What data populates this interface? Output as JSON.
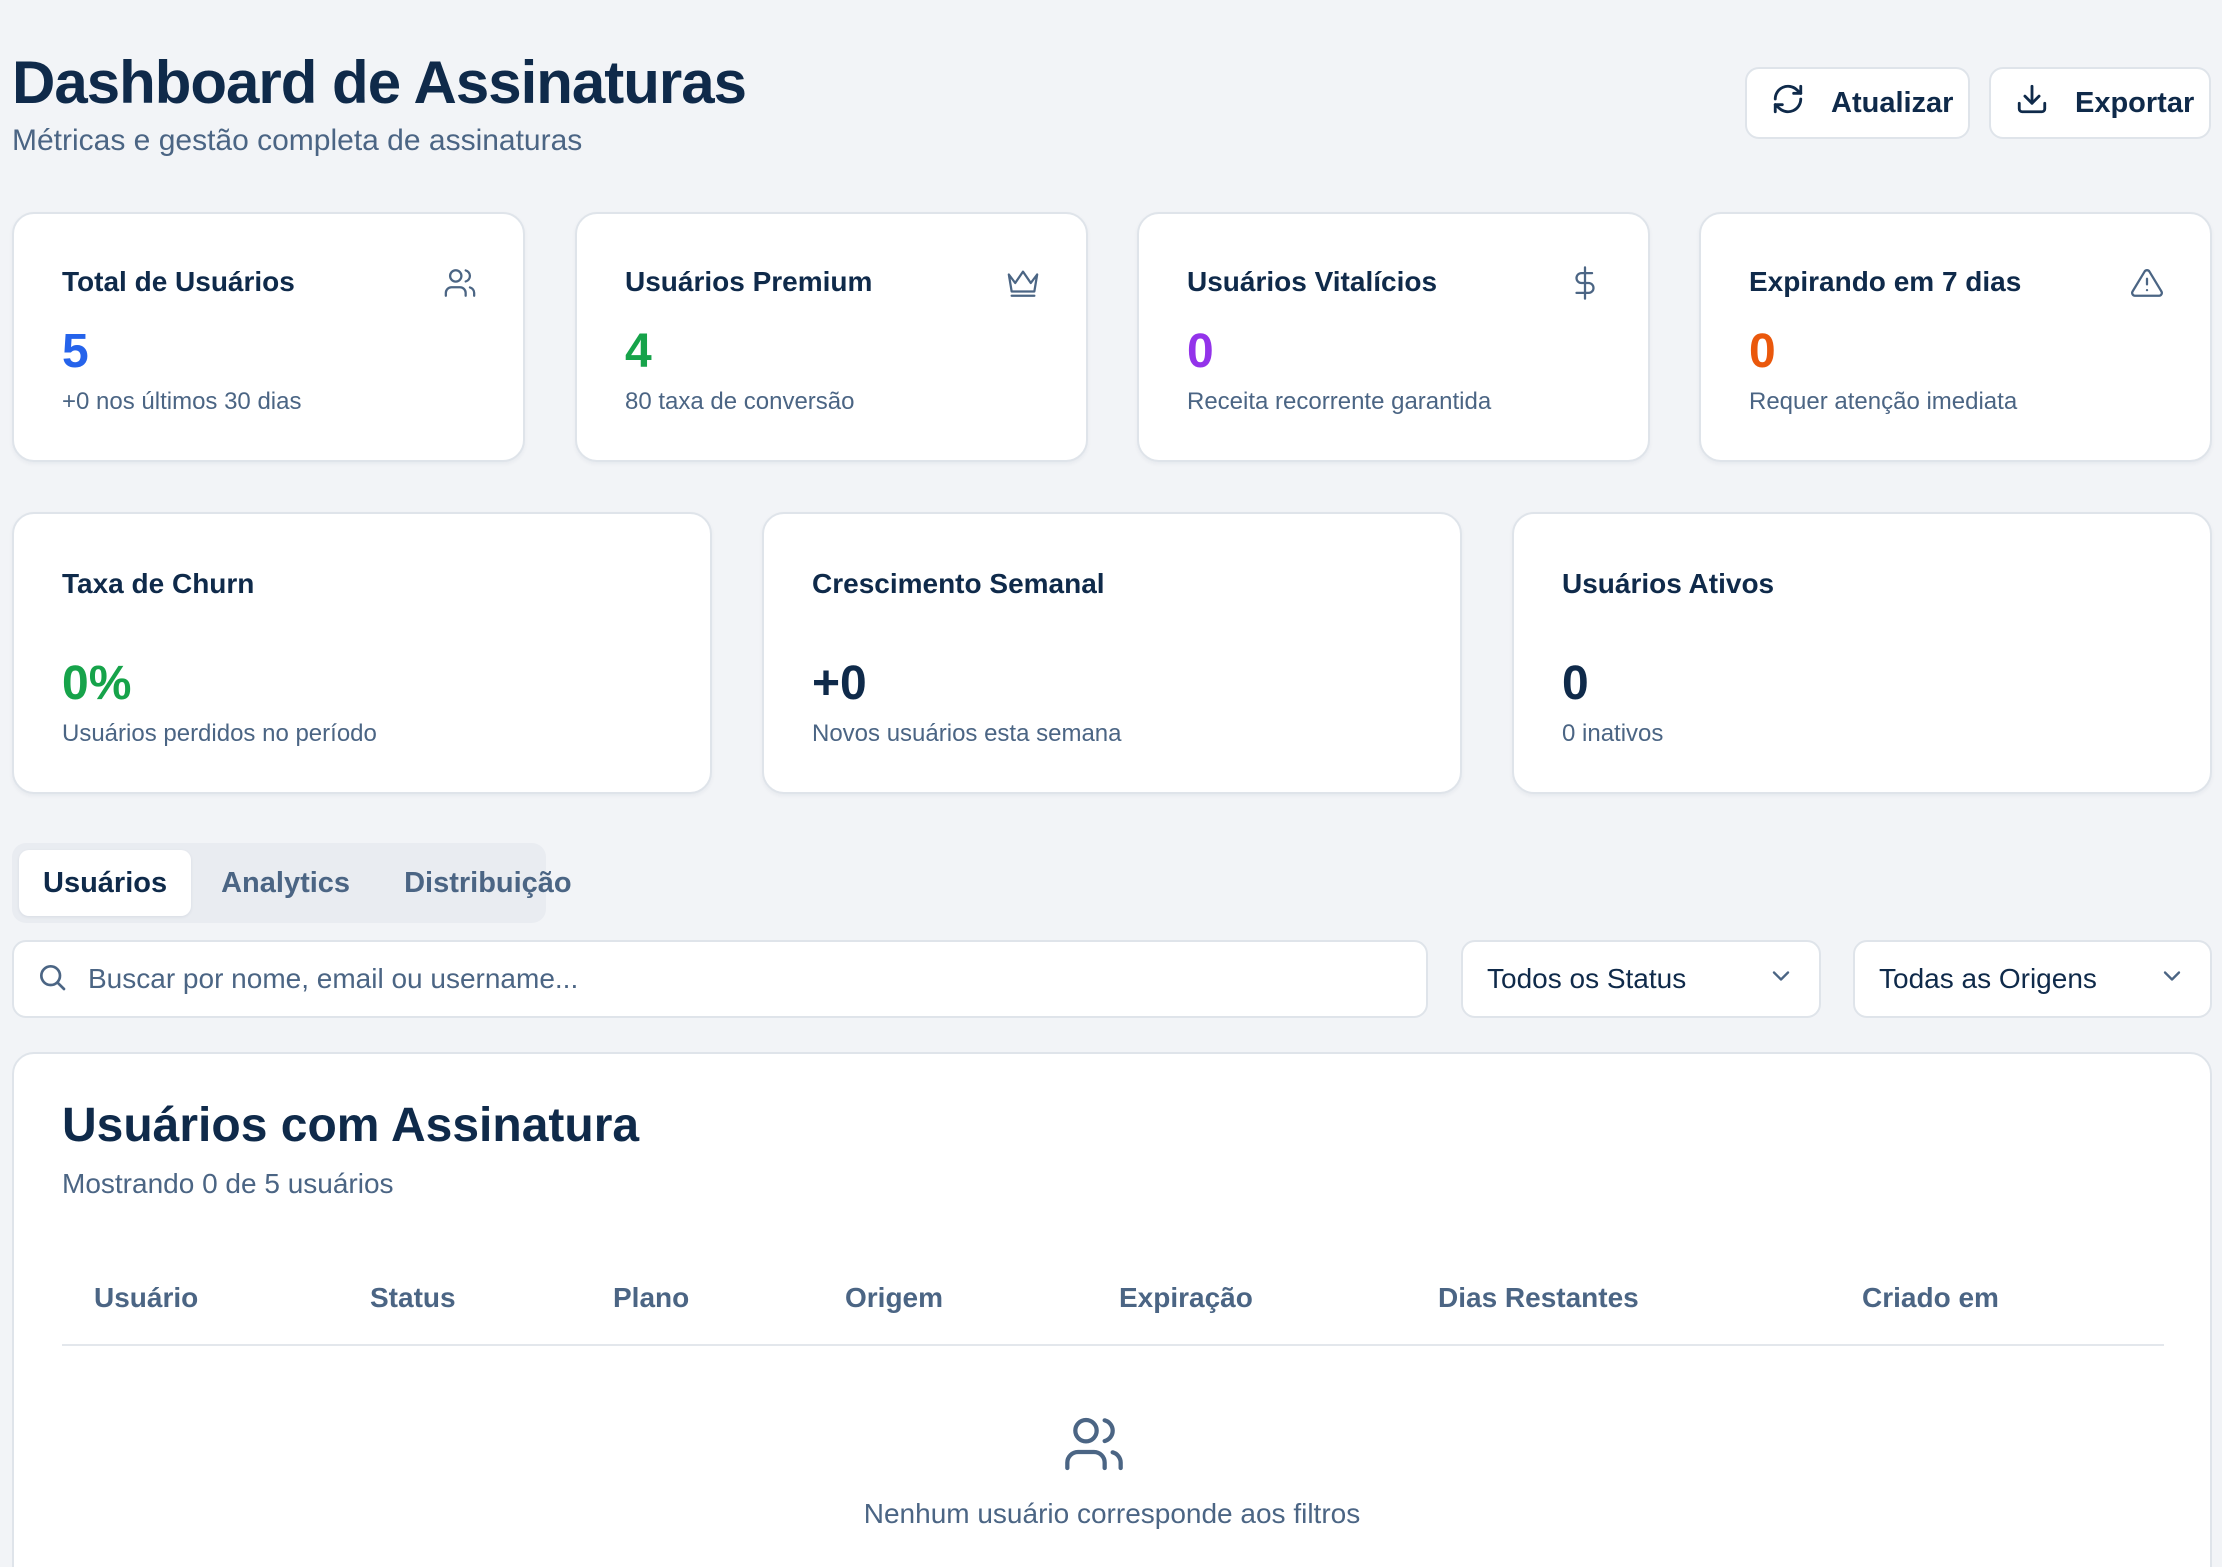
{
  "header": {
    "title": "Dashboard de Assinaturas",
    "subtitle": "Métricas e gestão completa de assinaturas",
    "refresh_label": "Atualizar",
    "export_label": "Exportar"
  },
  "stats": [
    {
      "title": "Total de Usuários",
      "value": "5",
      "subtitle": "+0 nos últimos 30 dias",
      "icon": "users-icon",
      "color": "#2563eb"
    },
    {
      "title": "Usuários Premium",
      "value": "4",
      "subtitle": "80 taxa de conversão",
      "icon": "crown-icon",
      "color": "#16a34a"
    },
    {
      "title": "Usuários Vitalícios",
      "value": "0",
      "subtitle": "Receita recorrente garantida",
      "icon": "dollar-icon",
      "color": "#9333ea"
    },
    {
      "title": "Expirando em 7 dias",
      "value": "0",
      "subtitle": "Requer atenção imediata",
      "icon": "alert-triangle-icon",
      "color": "#ea580c"
    }
  ],
  "metrics": [
    {
      "title": "Taxa de Churn",
      "value": "0%",
      "subtitle": "Usuários perdidos no período",
      "color": "#16a34a"
    },
    {
      "title": "Crescimento Semanal",
      "value": "+0",
      "subtitle": "Novos usuários esta semana",
      "color": "#0f2a4a"
    },
    {
      "title": "Usuários Ativos",
      "value": "0",
      "subtitle": "0 inativos",
      "color": "#0f2a4a"
    }
  ],
  "tabs": [
    {
      "label": "Usuários",
      "active": true
    },
    {
      "label": "Analytics",
      "active": false
    },
    {
      "label": "Distribuição",
      "active": false
    }
  ],
  "filters": {
    "search_placeholder": "Buscar por nome, email ou username...",
    "status_selected": "Todos os Status",
    "origin_selected": "Todas as Origens"
  },
  "table": {
    "title": "Usuários com Assinatura",
    "subtitle": "Mostrando 0 de 5 usuários",
    "columns": [
      "Usuário",
      "Status",
      "Plano",
      "Origem",
      "Expiração",
      "Dias Restantes",
      "Criado em"
    ],
    "empty_message": "Nenhum usuário corresponde aos filtros"
  }
}
